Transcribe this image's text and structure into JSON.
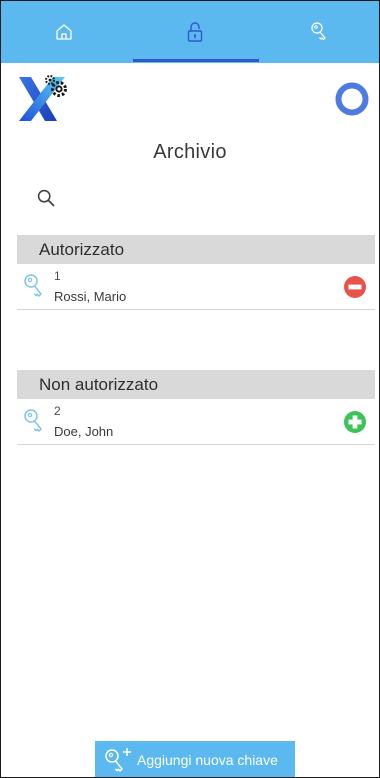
{
  "tabs": [
    {
      "icon": "home-icon",
      "active": false
    },
    {
      "icon": "lock-icon",
      "active": true
    },
    {
      "icon": "key-icon",
      "active": false
    }
  ],
  "header": {
    "logo": "x-gear-logo",
    "status_icon": "circle-icon"
  },
  "page": {
    "title": "Archivio"
  },
  "search": {
    "icon": "search-icon"
  },
  "sections": [
    {
      "label": "Autorizzato",
      "items": [
        {
          "number": "1",
          "name": "Rossi, Mario",
          "action": "remove-icon"
        }
      ]
    },
    {
      "label": "Non autorizzato",
      "items": [
        {
          "number": "2",
          "name": "Doe, John",
          "action": "add-icon"
        }
      ]
    }
  ],
  "footer": {
    "add_label": "Aggiungi nuova chiave"
  },
  "colors": {
    "accent": "#5bb9ef",
    "tab_underline": "#2e59c9",
    "remove": "#e9524a",
    "add": "#3cc35a",
    "section_bg": "#d9d9d9"
  }
}
